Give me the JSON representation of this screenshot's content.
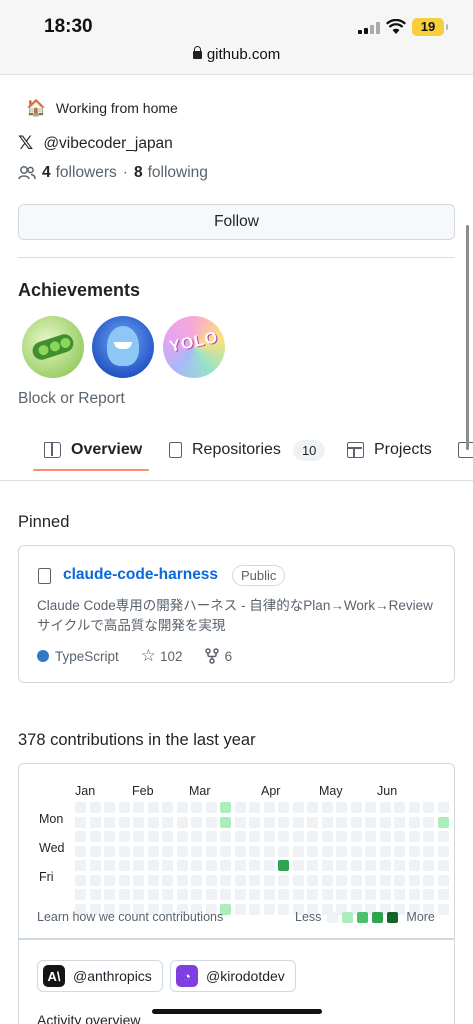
{
  "status_bar": {
    "time": "18:30",
    "battery": "19",
    "url": "github.com"
  },
  "profile": {
    "status_emoji": "🏠",
    "status": "Working from home",
    "x_handle": "@vibecoder_japan",
    "followers_count": "4",
    "followers_label": "followers",
    "separator": "·",
    "following_count": "8",
    "following_label": "following",
    "follow_button": "Follow"
  },
  "achievements": {
    "title": "Achievements",
    "badges": [
      "pair-extraordinaire-badge",
      "starstruck-badge",
      "yolo-badge"
    ]
  },
  "block_report": "Block or Report",
  "tabs": [
    {
      "label": "Overview",
      "icon": "book-icon",
      "active": true
    },
    {
      "label": "Repositories",
      "icon": "repo-icon",
      "count": "10"
    },
    {
      "label": "Projects",
      "icon": "table-icon"
    }
  ],
  "pinned": {
    "title": "Pinned",
    "repo": {
      "name": "claude-code-harness",
      "visibility": "Public",
      "description": "Claude Code専用の開発ハーネス - 自律的なPlan→Work→Review サイクルで高品質な開発を実現",
      "language": "TypeScript",
      "language_color": "#3178c6",
      "stars": "102",
      "forks": "6"
    }
  },
  "contributions": {
    "title": "378 contributions in the last year",
    "months": [
      "Jan",
      "Feb",
      "Mar",
      "Apr",
      "May",
      "Jun"
    ],
    "days": [
      "Mon",
      "Wed",
      "Fri"
    ],
    "learn": "Learn how we count contributions",
    "legend_less": "Less",
    "legend_more": "More",
    "levels": [
      "#eff2f5",
      "#aceebb",
      "#4ac26b",
      "#2da44e",
      "#116329"
    ]
  },
  "orgs": [
    {
      "name": "@anthropics",
      "icon": "anthropic-logo-icon",
      "glyph": "A\\"
    },
    {
      "name": "@kirodotdev",
      "icon": "kiro-ghost-icon",
      "glyph": "◔"
    }
  ],
  "activity_title": "Activity overview"
}
